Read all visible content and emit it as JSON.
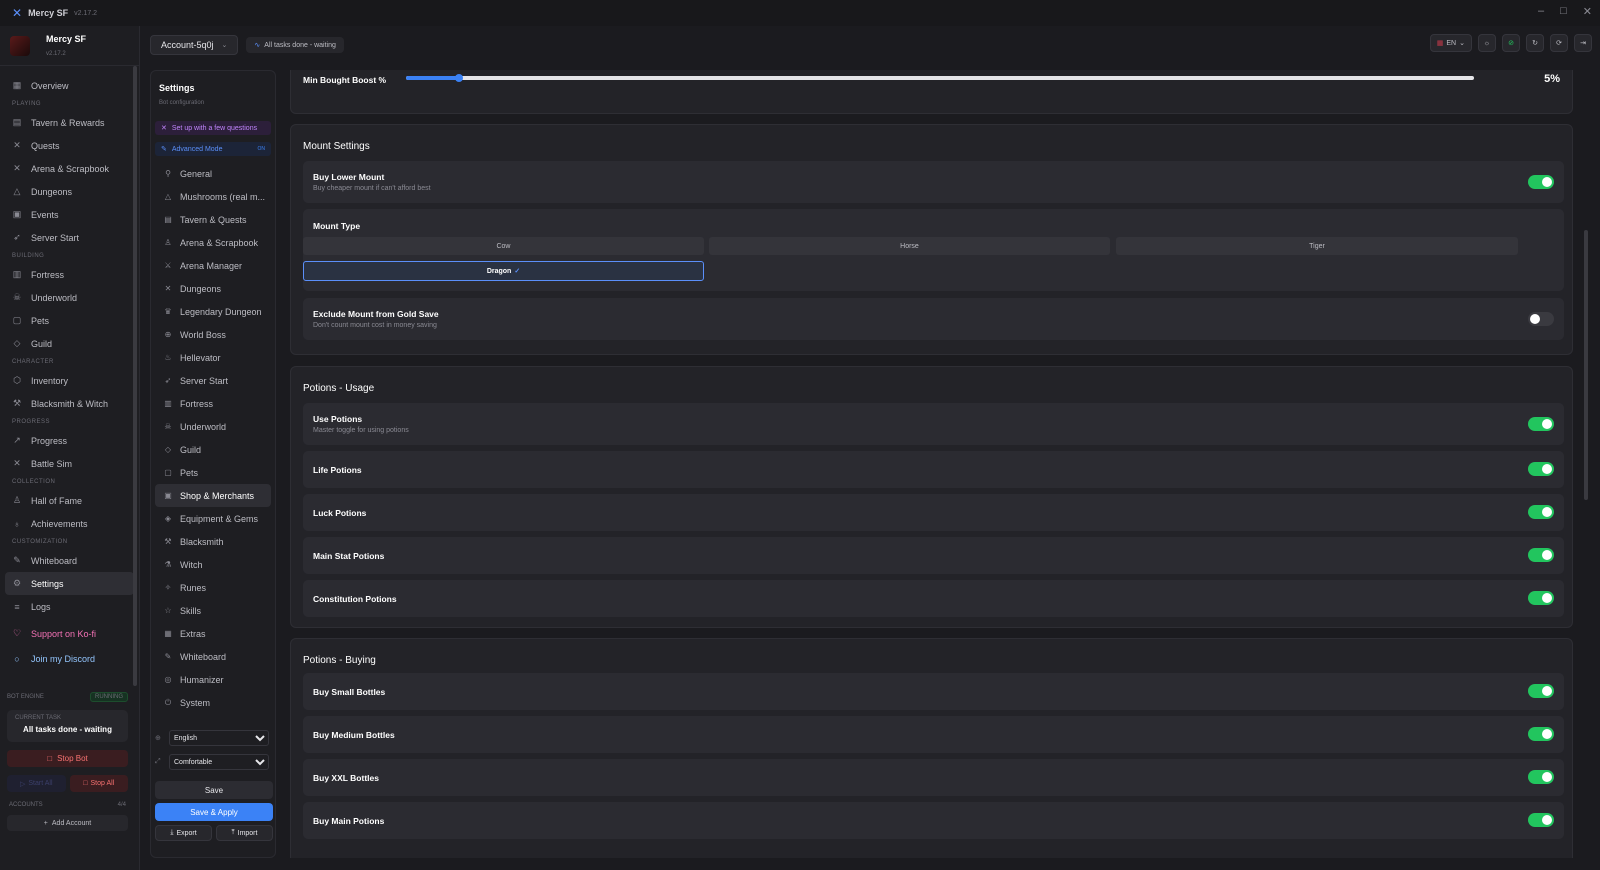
{
  "window": {
    "title": "Mercy SF",
    "version": "v2.17.2"
  },
  "profile": {
    "name": "Mercy SF",
    "version": "v2.17.2"
  },
  "sidebar": {
    "overview": "Overview",
    "sections": [
      "Playing",
      "Building",
      "Character",
      "Progress",
      "Collection",
      "Customization"
    ],
    "playing": [
      "Tavern & Rewards",
      "Quests",
      "Arena & Scrapbook",
      "Dungeons",
      "Events",
      "Server Start"
    ],
    "building": [
      "Fortress",
      "Underworld",
      "Pets",
      "Guild"
    ],
    "character": [
      "Inventory",
      "Blacksmith & Witch"
    ],
    "progress": [
      "Progress",
      "Battle Sim"
    ],
    "collection": [
      "Hall of Fame",
      "Achievements"
    ],
    "customization": [
      "Whiteboard",
      "Settings",
      "Logs"
    ],
    "kofi": "Support on Ko-fi",
    "discord": "Join my Discord"
  },
  "engine": {
    "label": "Bot Engine",
    "status": "RUNNING",
    "current_label": "Current Task",
    "current_value": "All tasks done - waiting",
    "stop_bot": "Stop Bot",
    "start_all": "Start All",
    "stop_all": "Stop All",
    "accounts_label": "Accounts",
    "accounts_count": "4/4",
    "add_account": "Add Account"
  },
  "topbar": {
    "account": "Account-5q0j",
    "status": "All tasks done - waiting",
    "lang": "EN"
  },
  "settings_nav": {
    "title": "Settings",
    "subtitle": "Bot configuration",
    "setup": "Set up with a few questions",
    "advanced": "Advanced Mode",
    "advanced_state": "ON",
    "items": [
      "General",
      "Mushrooms (real m...",
      "Tavern & Quests",
      "Arena & Scrapbook",
      "Arena Manager",
      "Dungeons",
      "Legendary Dungeon",
      "World Boss",
      "Hellevator",
      "Server Start",
      "Fortress",
      "Underworld",
      "Guild",
      "Pets",
      "Shop & Merchants",
      "Equipment & Gems",
      "Blacksmith",
      "Witch",
      "Runes",
      "Skills",
      "Extras",
      "Whiteboard",
      "Humanizer",
      "System"
    ],
    "language": "English",
    "language_prefix": "ca",
    "density": "Comfortable",
    "save": "Save",
    "save_apply": "Save & Apply",
    "export": "Export",
    "import": "Import"
  },
  "min_boost": {
    "label": "Min Bought Boost %",
    "value": "5%",
    "fraction": 0.05
  },
  "mount": {
    "title": "Mount Settings",
    "buy_lower": {
      "title": "Buy Lower Mount",
      "desc": "Buy cheaper mount if can't afford best",
      "on": true
    },
    "type_label": "Mount Type",
    "types": [
      "Cow",
      "Horse",
      "Tiger",
      "Dragon"
    ],
    "selected": "Dragon",
    "exclude": {
      "title": "Exclude Mount from Gold Save",
      "desc": "Don't count mount cost in money saving",
      "on": false
    }
  },
  "potions_usage": {
    "title": "Potions - Usage",
    "use": {
      "title": "Use Potions",
      "desc": "Master toggle for using potions"
    },
    "items": [
      "Life Potions",
      "Luck Potions",
      "Main Stat Potions",
      "Constitution Potions"
    ]
  },
  "potions_buying": {
    "title": "Potions - Buying",
    "items": [
      "Buy Small Bottles",
      "Buy Medium Bottles",
      "Buy XXL Bottles",
      "Buy Main Potions"
    ]
  },
  "colors": {
    "accent": "#3b82f6",
    "toggle_on": "#22c55e",
    "danger": "#f87171"
  }
}
